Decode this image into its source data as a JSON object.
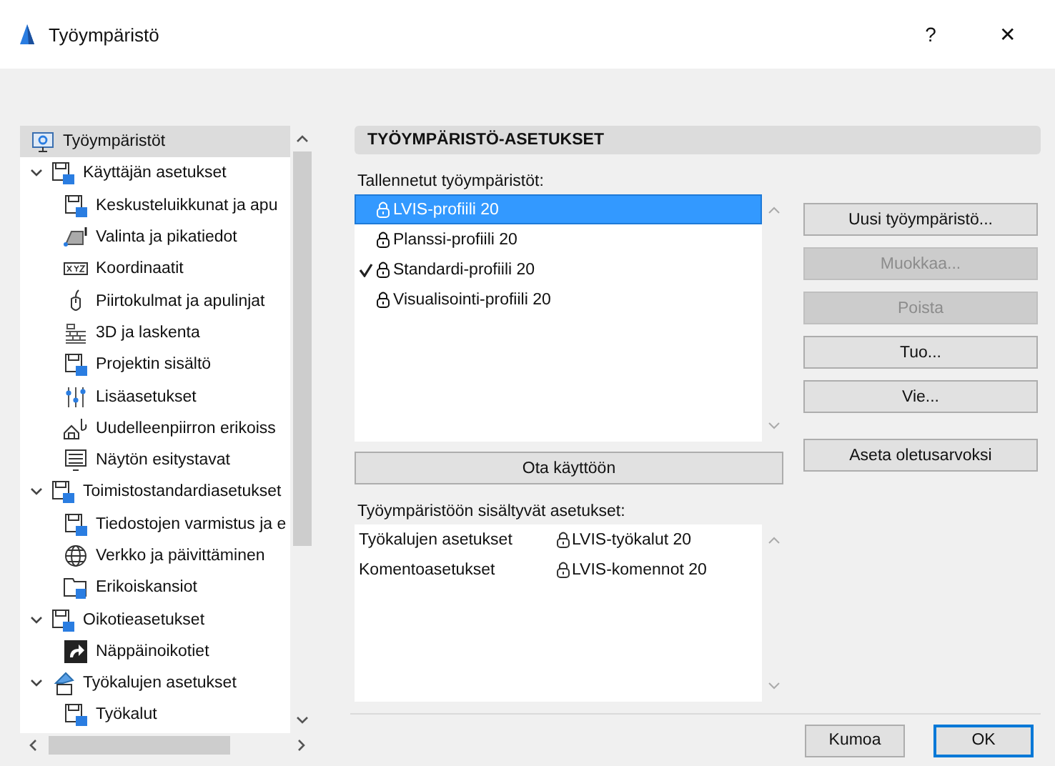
{
  "window": {
    "title": "Työympäristö",
    "help": "?",
    "close": "✕"
  },
  "tree": [
    {
      "label": "Työympäristöt",
      "selected": true
    },
    {
      "label": "Käyttäjän asetukset",
      "selected": false,
      "expanded": true,
      "children": [
        {
          "label": "Keskusteluikkunat ja apu",
          "selected": false
        },
        {
          "label": "Valinta ja pikatiedot",
          "selected": false
        },
        {
          "label": "Koordinaatit",
          "selected": false
        },
        {
          "label": "Piirtokulmat ja apulinjat",
          "selected": false
        },
        {
          "label": "3D ja laskenta",
          "selected": false
        },
        {
          "label": "Projektin sisältö",
          "selected": false
        },
        {
          "label": "Lisäasetukset",
          "selected": false
        },
        {
          "label": "Uudelleenpiirron erikoiss",
          "selected": false
        },
        {
          "label": "Näytön esitystavat",
          "selected": false
        }
      ]
    },
    {
      "label": "Toimistostandardiasetukset",
      "selected": false,
      "expanded": true,
      "children": [
        {
          "label": "Tiedostojen varmistus ja e",
          "selected": false
        },
        {
          "label": "Verkko ja päivittäminen",
          "selected": false
        },
        {
          "label": "Erikoiskansiot",
          "selected": false
        }
      ]
    },
    {
      "label": "Oikotieasetukset",
      "selected": false,
      "expanded": true,
      "children": [
        {
          "label": "Näppäinoikotiet",
          "selected": false
        }
      ]
    },
    {
      "label": "Työkalujen asetukset",
      "selected": false,
      "expanded": true,
      "children": [
        {
          "label": "Työkalut",
          "selected": false
        }
      ]
    }
  ],
  "section_title": "TYÖYMPÄRISTÖ-ASETUKSET",
  "saved_label": "Tallennetut työympäristöt:",
  "profiles": [
    {
      "label": "LVIS-profiili 20",
      "selected": true,
      "active": false
    },
    {
      "label": "Planssi-profiili 20",
      "selected": false,
      "active": false
    },
    {
      "label": "Standardi-profiili 20",
      "selected": false,
      "active": true
    },
    {
      "label": "Visualisointi-profiili 20",
      "selected": false,
      "active": false
    }
  ],
  "apply_button": "Ota käyttöön",
  "side_buttons": [
    {
      "label": "Uusi työympäristö...",
      "disabled": false
    },
    {
      "label": "Muokkaa...",
      "disabled": true
    },
    {
      "label": "Poista",
      "disabled": true
    },
    {
      "label": "Tuo...",
      "disabled": false
    },
    {
      "label": "Vie...",
      "disabled": false
    },
    {
      "label": "Aseta oletusarvoksi",
      "disabled": false
    }
  ],
  "included_label": "Työympäristöön sisältyvät asetukset:",
  "included": [
    {
      "setting": "Työkalujen asetukset",
      "profile": "LVIS-työkalut 20"
    },
    {
      "setting": "Komentoasetukset",
      "profile": "LVIS-komennot 20"
    }
  ],
  "footer_buttons": [
    {
      "label": "Kumoa",
      "default": false
    },
    {
      "label": "OK",
      "default": true
    }
  ]
}
